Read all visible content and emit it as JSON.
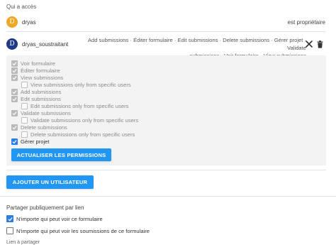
{
  "access": {
    "title": "Qui a accès"
  },
  "users": [
    {
      "initial": "D",
      "name": "dryas",
      "role": "est propriétaire"
    },
    {
      "initial": "D",
      "name": "dryas_soustraitant",
      "permissions_line1": "Add submissions · Éditer formulaire · Edit submissions · Delete submissions · Gérer projet · Validate",
      "permissions_line2": "submissions · Voir formulaire · View submissions"
    }
  ],
  "permissions": [
    {
      "label": "Voir formulaire",
      "state": "checked-disabled"
    },
    {
      "label": "Éditer formulaire",
      "state": "checked-disabled"
    },
    {
      "label": "View submissions",
      "state": "checked-disabled"
    },
    {
      "label": "View submissions only from specific users",
      "state": "unchecked-disabled"
    },
    {
      "label": "Add submissions",
      "state": "checked-disabled"
    },
    {
      "label": "Edit submissions",
      "state": "checked-disabled"
    },
    {
      "label": "Edit submissions only from specific users",
      "state": "unchecked-disabled"
    },
    {
      "label": "Validate submissions",
      "state": "checked-disabled"
    },
    {
      "label": "Validate submissions only from specific users",
      "state": "unchecked-disabled"
    },
    {
      "label": "Delete submissions",
      "state": "checked-disabled"
    },
    {
      "label": "Delete submissions only from specific users",
      "state": "unchecked-disabled"
    },
    {
      "label": "Gérer projet",
      "state": "checked"
    }
  ],
  "buttons": {
    "update_permissions": "ACTUALISER LES PERMISSIONS",
    "add_user": "AJOUTER UN UTILISATEUR"
  },
  "share": {
    "title": "Partager publiquement par lien",
    "options": [
      {
        "label": "N'importe qui peut voir ce formulaire",
        "checked": true
      },
      {
        "label": "N'importe qui peut voir les soumissions de ce formulaire",
        "checked": false
      }
    ],
    "link_label": "Lien à partager"
  },
  "colors": {
    "primary": "#2196f3",
    "checkbox_blue": "#2b7de9",
    "owner_avatar": "#f0a824",
    "user_avatar": "#1f3b87",
    "panel_bg": "#f3f3f3"
  },
  "icons": {
    "remove": "close-icon",
    "delete": "trash-icon",
    "check": "check-icon"
  }
}
